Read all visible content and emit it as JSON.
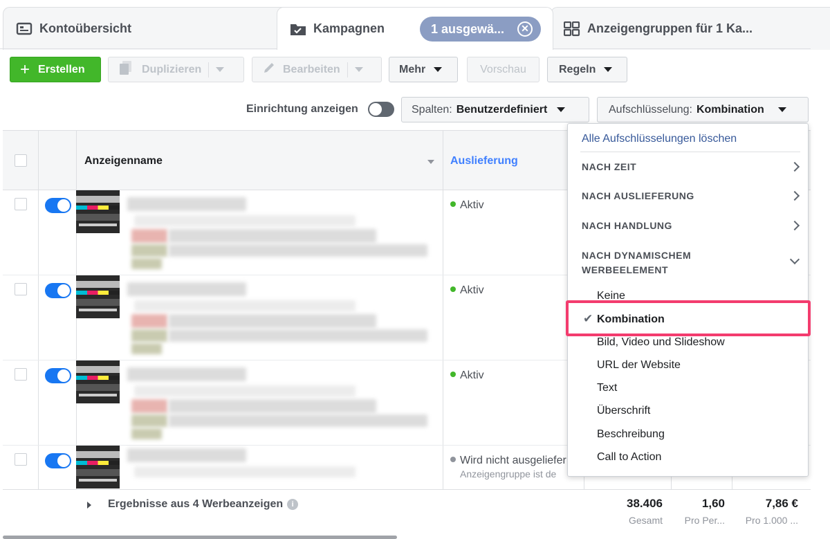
{
  "tabs": {
    "account_overview": "Kontoübersicht",
    "campaigns": "Kampagnen",
    "selected_chip": "1 ausgewä...",
    "ad_groups": "Anzeigengruppen für 1 Ka..."
  },
  "toolbar": {
    "create": "Erstellen",
    "duplicate": "Duplizieren",
    "edit": "Bearbeiten",
    "more": "Mehr",
    "preview": "Vorschau",
    "rules": "Regeln",
    "setup_label": "Einrichtung anzeigen",
    "columns_prefix": "Spalten:",
    "columns_value": "Benutzerdefiniert",
    "breakdown_prefix": "Aufschlüsselung:",
    "breakdown_value": "Kombination"
  },
  "table": {
    "col_name": "Anzeigenname",
    "col_delivery": "Auslieferung",
    "rows": [
      {
        "status": "Aktiv",
        "sub": ""
      },
      {
        "status": "Aktiv",
        "sub": ""
      },
      {
        "status": "Aktiv",
        "sub": ""
      },
      {
        "status": "Wird nicht ausgeliefer",
        "sub": "Anzeigengruppe ist de"
      }
    ],
    "footer": {
      "label": "Ergebnisse aus 4 Werbeanzeigen",
      "metrics": [
        {
          "value": "38.406",
          "label": "Gesamt"
        },
        {
          "value": "1,60",
          "label": "Pro Per..."
        },
        {
          "value": "7,86 €",
          "label": "Pro 1.000 ..."
        }
      ]
    }
  },
  "breakdown_menu": {
    "clear": "Alle Aufschlüsselungen löschen",
    "sections": [
      "NACH ZEIT",
      "NACH AUSLIEFERUNG",
      "NACH HANDLUNG",
      "NACH DYNAMISCHEM",
      "WERBEELEMENT"
    ],
    "options": [
      "Keine",
      "Kombination",
      "Bild, Video und Slideshow",
      "URL der Website",
      "Text",
      "Überschrift",
      "Beschreibung",
      "Call to Action"
    ],
    "selected": "Kombination"
  },
  "colors": {
    "primary_green": "#42b72a",
    "toggle_blue": "#1877f2",
    "highlight": "#f33c6e",
    "link": "#4080ff"
  }
}
